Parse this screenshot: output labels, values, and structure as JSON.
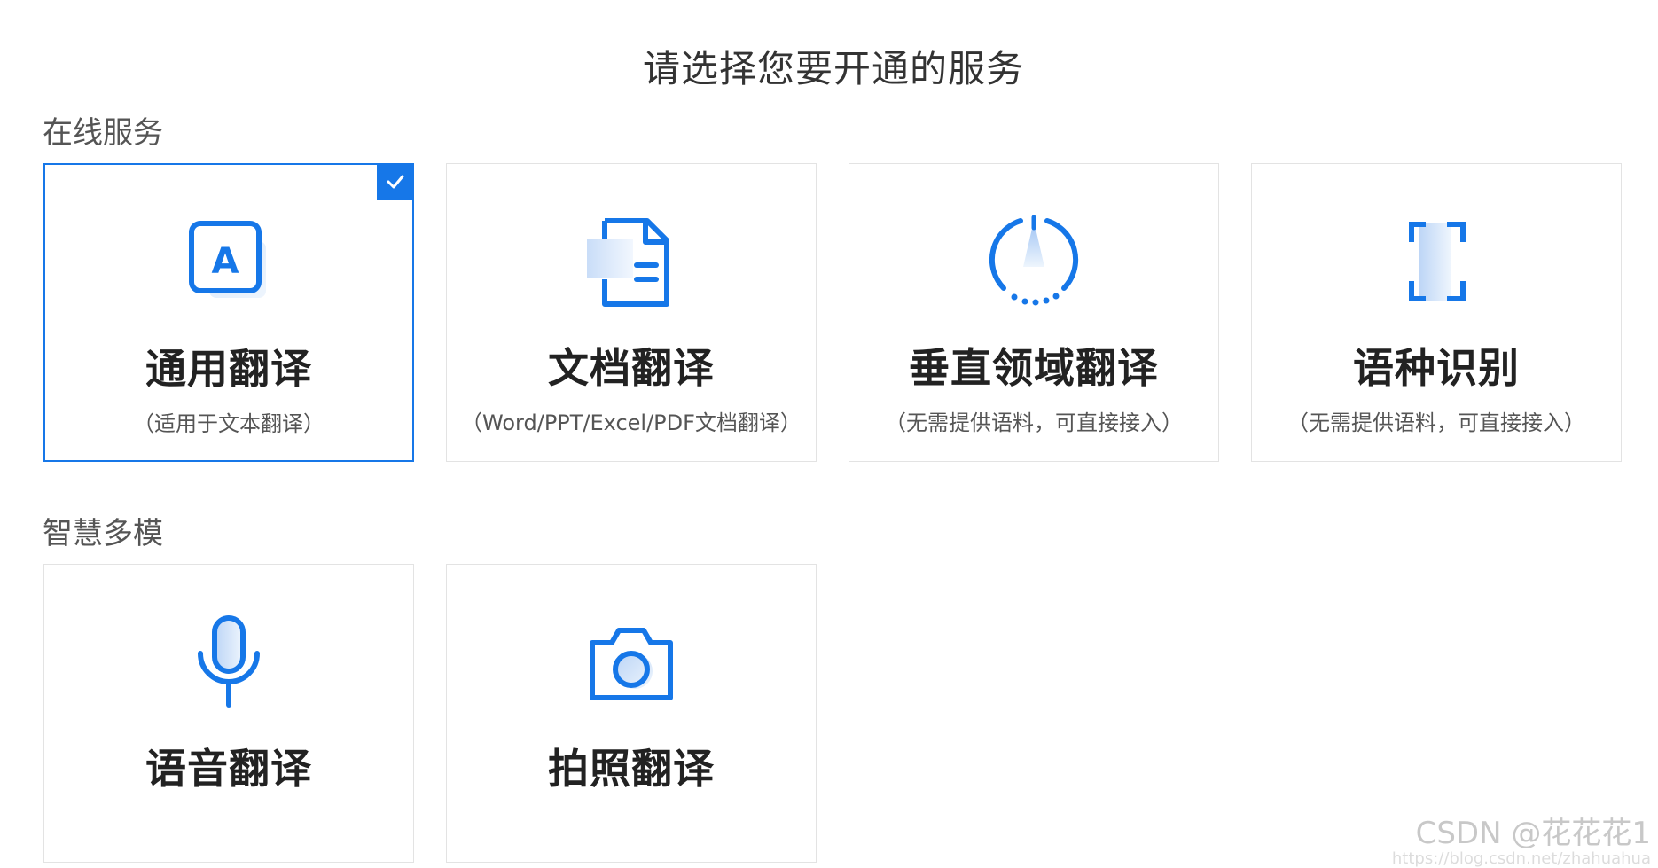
{
  "header": {
    "title": "请选择您要开通的服务"
  },
  "sections": [
    {
      "title": "在线服务",
      "cards": [
        {
          "name": "通用翻译",
          "desc": "（适用于文本翻译）",
          "icon": "text-translate-icon",
          "selected": true
        },
        {
          "name": "文档翻译",
          "desc": "（Word/PPT/Excel/PDF文档翻译）",
          "icon": "document-icon",
          "selected": false
        },
        {
          "name": "垂直领域翻译",
          "desc": "（无需提供语料，可直接接入）",
          "icon": "domain-compass-icon",
          "selected": false
        },
        {
          "name": "语种识别",
          "desc": "（无需提供语料，可直接接入）",
          "icon": "scan-frame-icon",
          "selected": false
        }
      ]
    },
    {
      "title": "智慧多模",
      "cards": [
        {
          "name": "语音翻译",
          "desc": "",
          "icon": "microphone-icon",
          "selected": false
        },
        {
          "name": "拍照翻译",
          "desc": "",
          "icon": "camera-icon",
          "selected": false
        }
      ]
    }
  ],
  "watermark": {
    "text": "CSDN @花花花1",
    "url": "https://blog.csdn.net/zhahuahua"
  },
  "colors": {
    "accent": "#1677e8",
    "border": "#e3e3e3",
    "text": "#222222"
  }
}
